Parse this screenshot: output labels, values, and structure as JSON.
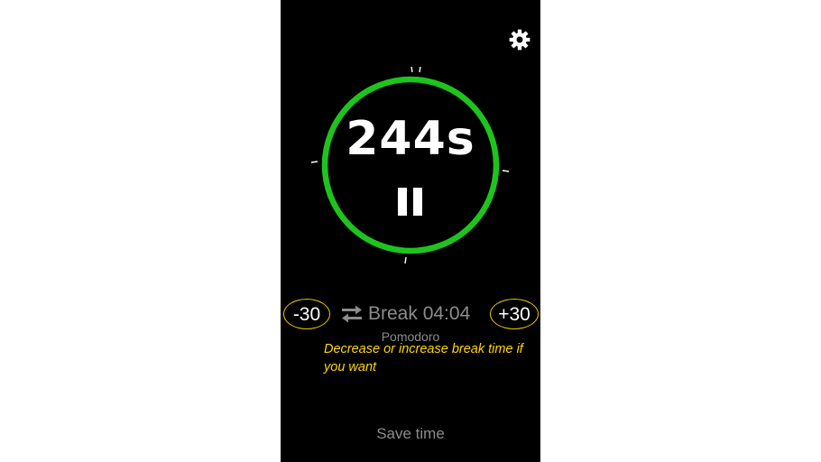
{
  "timer": {
    "value": "244s",
    "ring_color": "#1ec41e",
    "pause_icon": "pause-icon"
  },
  "header": {
    "settings_icon": "gear-icon"
  },
  "controls": {
    "decrease_label": "-30",
    "increase_label": "+30",
    "highlight_color": "#e8c800",
    "mode_icon": "swap-arrows-icon",
    "mode_text": "Break 04:04",
    "preset_label": "Pomodoro"
  },
  "annotation": {
    "text": "Decrease or increase break time if you want",
    "color": "#ffd700"
  },
  "footer": {
    "save_label": "Save time"
  }
}
